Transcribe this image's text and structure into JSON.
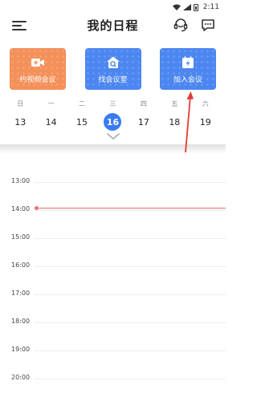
{
  "status_bar": {
    "time": "2:11"
  },
  "header": {
    "title": "我的日程"
  },
  "quick_actions": [
    {
      "label": "约视频会议",
      "color": "#f4905a",
      "icon": "video-plus-icon"
    },
    {
      "label": "找会议室",
      "color": "#4c86f0",
      "icon": "room-search-icon"
    },
    {
      "label": "加入会议",
      "color": "#4c86f0",
      "icon": "join-lightning-icon"
    }
  ],
  "week": {
    "days": [
      {
        "weekday": "日",
        "date": "13"
      },
      {
        "weekday": "一",
        "date": "14"
      },
      {
        "weekday": "二",
        "date": "15"
      },
      {
        "weekday": "三",
        "date": "16",
        "today": true
      },
      {
        "weekday": "四",
        "date": "17"
      },
      {
        "weekday": "五",
        "date": "18"
      },
      {
        "weekday": "六",
        "date": "19"
      }
    ]
  },
  "timeline": {
    "hours": [
      "13:00",
      "14:00",
      "15:00",
      "16:00",
      "17:00",
      "18:00",
      "19:00",
      "20:00"
    ],
    "current_time_hour": 13.9
  },
  "colors": {
    "accent": "#3a7bf2",
    "now_line": "#ee6e6e",
    "annotation_arrow": "#e53935"
  }
}
